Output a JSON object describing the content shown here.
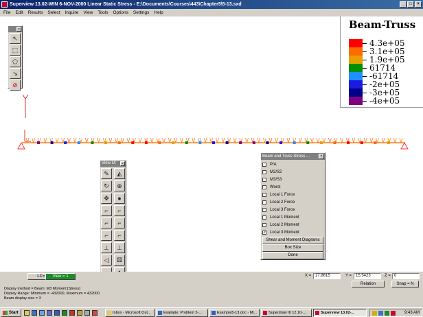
{
  "window": {
    "title": "Superview 13.02-WIN 6-NOV-2000 Linear Static Stress - E:\\Documents\\Courses\\443\\Chapter5\\5-13.sxd"
  },
  "menu": [
    "File",
    "Edit",
    "Results",
    "Select",
    "Inquire",
    "View",
    "Tools",
    "Options",
    "Settings",
    "Help"
  ],
  "legend": {
    "title": "Beam-Truss",
    "entries": [
      {
        "label": "4.3e+05",
        "color": "#ff0000"
      },
      {
        "label": "3.1e+05",
        "color": "#ff6a00"
      },
      {
        "label": "1.9e+05",
        "color": "#e6a000"
      },
      {
        "label": "61714",
        "color": "#008f00"
      },
      {
        "label": "-61714",
        "color": "#1e90ff"
      },
      {
        "label": "-2e+05",
        "color": "#1a1ae0"
      },
      {
        "label": "-3e+05",
        "color": "#00008b"
      },
      {
        "label": "-4e+05",
        "color": "#800080"
      }
    ]
  },
  "view_toolbar": {
    "title": "View Ut"
  },
  "stress_panel": {
    "title": "Beam and Truss Stress ...",
    "options": [
      {
        "label": "P/A",
        "checked": false
      },
      {
        "label": "M2/S2",
        "checked": false
      },
      {
        "label": "M3/S3",
        "checked": false
      },
      {
        "label": "Worst",
        "checked": false
      },
      {
        "label": "Local 1 Force",
        "checked": false
      },
      {
        "label": "Local 2 Force",
        "checked": false
      },
      {
        "label": "Local 3 Force",
        "checked": false
      },
      {
        "label": "Local 1 Moment",
        "checked": false
      },
      {
        "label": "Local 2 Moment",
        "checked": false
      },
      {
        "label": "Local 3 Moment",
        "checked": true
      }
    ],
    "buttons": {
      "shear_moment": "Shear and Moment Diagrams",
      "box_size": "Box Size",
      "done": "Done"
    }
  },
  "status": {
    "lc": "LC=1/1",
    "view": "View = 1",
    "x_label": "X =",
    "x_value": "17.8615",
    "y_label": "Y =",
    "y_value": "15.5423",
    "z_label": "Z =",
    "z_value": "0",
    "relation": "Relation",
    "snap": "Snap = N",
    "messages": [
      "Display method = Beam: M3 Moment  [Stress]",
      "Display Range: Minimum = -432000, Maximum = 432000",
      "Beam display size = 3"
    ]
  },
  "taskbar": {
    "start": "Start",
    "tasks": [
      {
        "label": "Inbox - Microsoft Out..."
      },
      {
        "label": "Example: Problem 5-..."
      },
      {
        "label": "Example5-13.doc - Mi..."
      },
      {
        "label": "Superdraw III 12.10-..."
      },
      {
        "label": "Superview 13.02-...",
        "active": true
      }
    ],
    "clock": "9:43 AM"
  },
  "colors": {
    "beam": "#ff7f1e",
    "support": "#ff3030",
    "titlebar_start": "#0a246a",
    "view_indicator": "#1f8a2a"
  }
}
